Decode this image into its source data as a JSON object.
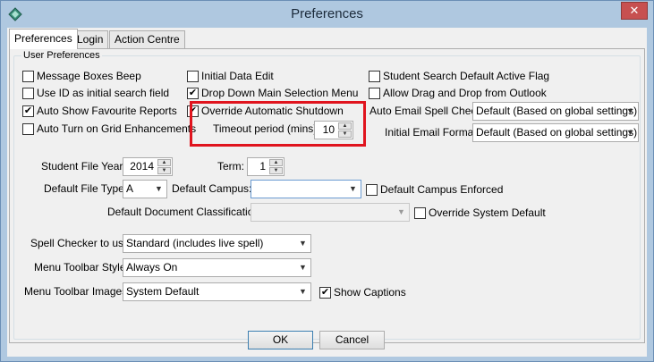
{
  "window": {
    "title": "Preferences",
    "close_glyph": "✕",
    "app_icon": "diamond-icon"
  },
  "tabs": [
    {
      "label": "Preferences",
      "active": true
    },
    {
      "label": "Login",
      "active": false
    },
    {
      "label": "Action Centre",
      "active": false
    }
  ],
  "group_title": "User Preferences",
  "checkboxes": {
    "message_boxes_beep": {
      "label": "Message Boxes Beep",
      "checked": false
    },
    "use_id_search": {
      "label": "Use ID as initial search field",
      "checked": false
    },
    "auto_show_reports": {
      "label": "Auto Show Favourite Reports",
      "checked": true
    },
    "auto_turn_grid": {
      "label": "Auto Turn on Grid Enhancements",
      "checked": false
    },
    "initial_data_edit": {
      "label": "Initial Data Edit",
      "checked": false
    },
    "drop_down_menu": {
      "label": "Drop Down Main Selection Menu",
      "checked": true
    },
    "override_shutdown": {
      "label": "Override Automatic Shutdown",
      "checked": true
    },
    "student_search_flag": {
      "label": "Student Search Default Active Flag",
      "checked": false
    },
    "allow_drag_drop": {
      "label": "Allow Drag and Drop from Outlook",
      "checked": false
    },
    "default_campus_enforced": {
      "label": "Default Campus Enforced",
      "checked": false
    },
    "override_system_default": {
      "label": "Override System Default",
      "checked": false
    },
    "show_captions": {
      "label": "Show Captions",
      "checked": true
    }
  },
  "timeout": {
    "label": "Timeout period (mins):",
    "value": "10"
  },
  "auto_email_spell": {
    "label": "Auto Email Spell Check:",
    "value": "Default (Based on global settings)"
  },
  "initial_email_format": {
    "label": "Initial Email Format:",
    "value": "Default (Based on global settings)"
  },
  "student_file_year": {
    "label": "Student File Year:",
    "value": "2014"
  },
  "term": {
    "label": "Term:",
    "value": "1"
  },
  "default_file_type": {
    "label": "Default File Type:",
    "value": "A"
  },
  "default_campus": {
    "label": "Default Campus:",
    "value": ""
  },
  "default_doc_class": {
    "label": "Default Document Classification:",
    "value": ""
  },
  "spell_checker": {
    "label": "Spell Checker to use:",
    "value": "Standard (includes live spell)"
  },
  "menu_toolbar_style": {
    "label": "Menu Toolbar Style:",
    "value": "Always On"
  },
  "menu_toolbar_images": {
    "label": "Menu Toolbar Images:",
    "value": "System Default"
  },
  "buttons": {
    "ok": "OK",
    "cancel": "Cancel"
  },
  "glyphs": {
    "dropdown": "▼",
    "up": "▲",
    "down": "▼"
  }
}
